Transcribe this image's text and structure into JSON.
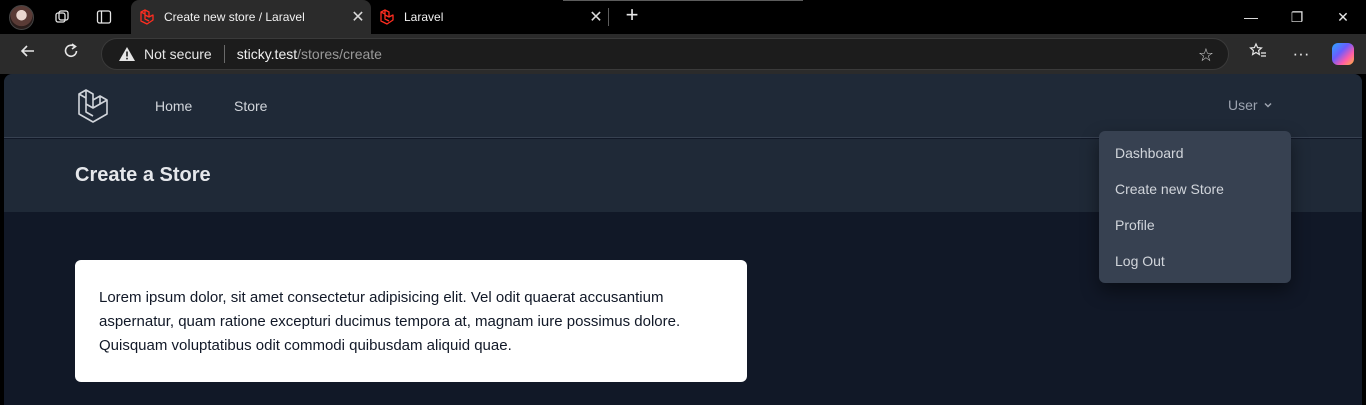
{
  "browser": {
    "tabs": [
      {
        "title": "Create new store / Laravel",
        "active": true
      },
      {
        "title": "Laravel",
        "active": false
      }
    ],
    "close_glyph": "✕",
    "new_tab_glyph": "+",
    "address": {
      "security_label": "Not secure",
      "host": "sticky.test",
      "path": "/stores/create"
    },
    "window_controls": {
      "minimize": "—",
      "restore": "❐",
      "close": "✕"
    }
  },
  "app": {
    "nav": {
      "home_label": "Home",
      "store_label": "Store"
    },
    "user_menu": {
      "label": "User",
      "items": [
        "Dashboard",
        "Create new Store",
        "Profile",
        "Log Out"
      ]
    },
    "header": {
      "title": "Create a Store"
    },
    "card": {
      "text": "Lorem ipsum dolor, sit amet consectetur adipisicing elit. Vel odit quaerat accusantium aspernatur, quam ratione excepturi ducimus tempora at, magnam iure possimus dolore. Quisquam voluptatibus odit commodi quibusdam aliquid quae."
    }
  },
  "colors": {
    "laravel_red": "#ff2d20",
    "page_bg": "#111827",
    "nav_bg": "#1f2937",
    "dropdown_bg": "#374151"
  },
  "icons": [
    "profile-avatar-icon",
    "workspaces-icon",
    "tab-actions-icon",
    "laravel-favicon-icon",
    "back-arrow-icon",
    "refresh-icon",
    "warning-icon",
    "star-icon",
    "favorites-icon",
    "more-icon",
    "copilot-icon",
    "laravel-logo-icon",
    "chevron-down-icon"
  ]
}
